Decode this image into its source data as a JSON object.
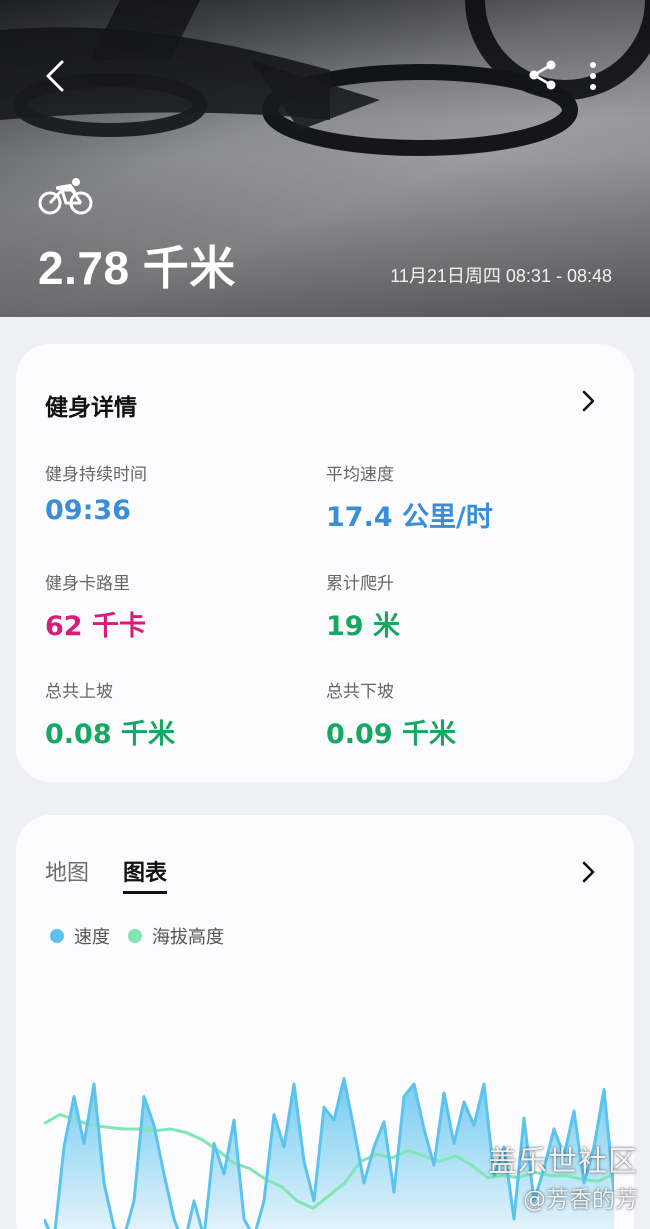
{
  "header": {
    "distance": "2.78 千米",
    "time_range": "11月21日周四 08:31 - 08:48",
    "icons": {
      "back": "chevron-left-icon",
      "share": "share-icon",
      "more": "more-vertical-icon",
      "activity": "cycling-icon"
    }
  },
  "details": {
    "title": "健身详情",
    "stats": [
      {
        "label": "健身持续时间",
        "value": "09:36",
        "color": "#3a8ed8"
      },
      {
        "label": "平均速度",
        "value": "17.4 公里/时",
        "color": "#3a8ed8"
      },
      {
        "label": "健身卡路里",
        "value": "62 千卡",
        "color": "#d61e78"
      },
      {
        "label": "累计爬升",
        "value": "19 米",
        "color": "#16a862"
      },
      {
        "label": "总共上坡",
        "value": "0.08 千米",
        "color": "#16a862"
      },
      {
        "label": "总共下坡",
        "value": "0.09 千米",
        "color": "#16a862"
      }
    ]
  },
  "chart_section": {
    "tabs": [
      {
        "label": "地图",
        "active": false
      },
      {
        "label": "图表",
        "active": true
      }
    ],
    "legend": [
      {
        "label": "速度",
        "color": "#5cc3ee"
      },
      {
        "label": "海拔高度",
        "color": "#7fe6b4"
      }
    ]
  },
  "chart_data": {
    "type": "area",
    "series": [
      {
        "name": "速度",
        "values": [
          20,
          8,
          60,
          88,
          62,
          95,
          40,
          15,
          10,
          30,
          88,
          72,
          45,
          20,
          5,
          30,
          10,
          62,
          45,
          75,
          20,
          10,
          30,
          78,
          60,
          95,
          52,
          30,
          82,
          75,
          98,
          70,
          40,
          60,
          74,
          35,
          88,
          95,
          70,
          50,
          90,
          62,
          85,
          72,
          95,
          44,
          60,
          20,
          76,
          30,
          48,
          70,
          55,
          80,
          40,
          60,
          92,
          35
        ]
      },
      {
        "name": "海拔高度",
        "values": [
          73,
          78,
          75,
          72,
          71,
          70,
          70,
          69,
          70,
          68,
          64,
          58,
          51,
          48,
          42,
          38,
          30,
          26,
          33,
          40,
          52,
          56,
          54,
          58,
          55,
          52,
          55,
          50,
          43,
          44,
          43,
          46,
          44,
          44,
          42,
          41,
          45
        ]
      }
    ]
  },
  "watermark": {
    "line1": "盖乐世社区",
    "line2": "@芳香的芳"
  }
}
